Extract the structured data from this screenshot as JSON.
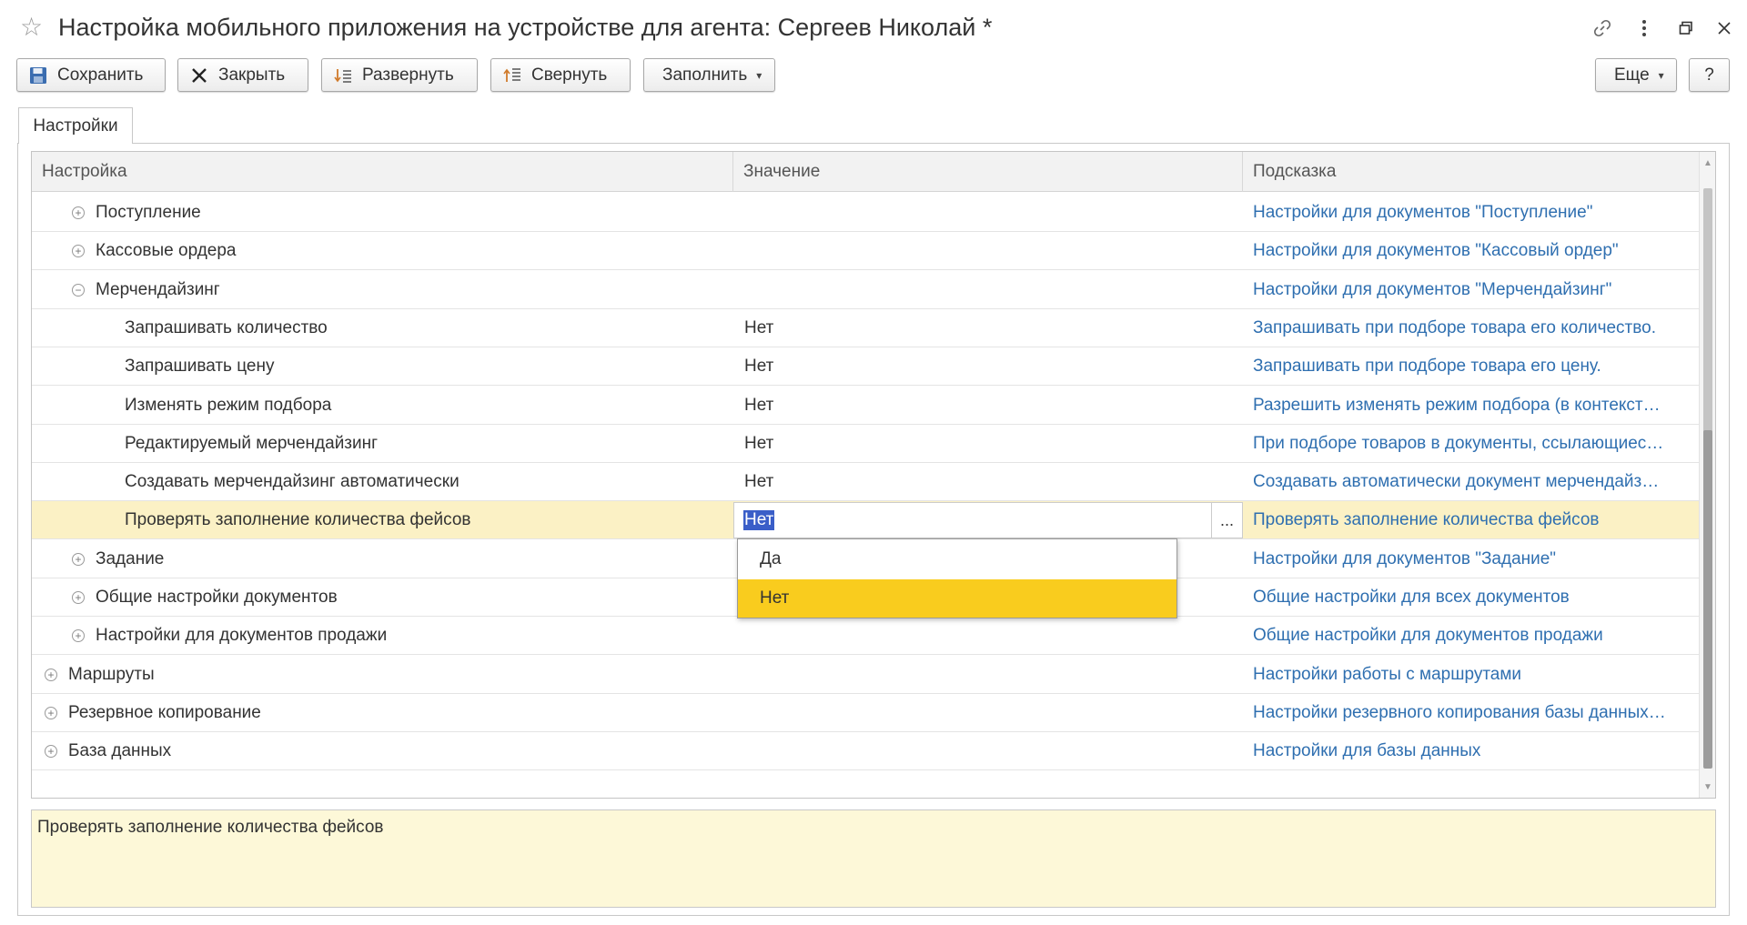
{
  "window": {
    "title": "Настройка мобильного приложения на устройстве для агента: Сергеев Николай *",
    "icons": [
      "star-icon",
      "link-icon",
      "more-icon",
      "restore-icon",
      "close-icon"
    ]
  },
  "toolbar": {
    "save_label": "Сохранить",
    "close_label": "Закрыть",
    "expand_label": "Развернуть",
    "collapse_label": "Свернуть",
    "fill_label": "Заполнить",
    "more_label": "Еще",
    "help_label": "?"
  },
  "tabs": [
    {
      "label": "Настройки"
    }
  ],
  "grid": {
    "columns": [
      "Настройка",
      "Значение",
      "Подсказка"
    ],
    "rows": [
      {
        "name": "Поступление",
        "expander": "+",
        "value": "",
        "hint": "Настройки для документов \"Поступление\""
      },
      {
        "name": "Кассовые ордера",
        "expander": "+",
        "value": "",
        "hint": "Настройки для документов \"Кассовый ордер\""
      },
      {
        "name": "Мерчендайзинг",
        "expander": "−",
        "value": "",
        "hint": "Настройки для документов \"Мерчендайзинг\""
      },
      {
        "name": "Запрашивать количество",
        "expander": "",
        "value": "Нет",
        "hint": "Запрашивать при подборе товара его количество."
      },
      {
        "name": "Запрашивать цену",
        "expander": "",
        "value": "Нет",
        "hint": "Запрашивать при подборе товара его цену."
      },
      {
        "name": "Изменять режим подбора",
        "expander": "",
        "value": "Нет",
        "hint": "Разрешить изменять режим подбора (в контекст…"
      },
      {
        "name": "Редактируемый мерчендайзинг",
        "expander": "",
        "value": "Нет",
        "hint": "При подборе товаров в документы, ссылающиес…"
      },
      {
        "name": "Создавать мерчендайзинг автоматически",
        "expander": "",
        "value": "Нет",
        "hint": "Создавать автоматически документ мерчендайз…"
      },
      {
        "name": "Проверять заполнение количества фейсов",
        "expander": "",
        "value": "Нет",
        "hint": "Проверять заполнение количества фейсов",
        "selected": true,
        "editing": true
      },
      {
        "name": "Задание",
        "expander": "+",
        "value": "",
        "hint": "Настройки для документов \"Задание\""
      },
      {
        "name": "Общие настройки документов",
        "expander": "+",
        "value": "",
        "hint": "Общие настройки для всех документов"
      },
      {
        "name": "Настройки для документов продажи",
        "expander": "+",
        "value": "",
        "hint": "Общие настройки для документов продажи"
      },
      {
        "name": "Маршруты",
        "expander": "+",
        "value": "",
        "hint": "Настройки работы с маршрутами"
      },
      {
        "name": "Резервное копирование",
        "expander": "+",
        "value": "",
        "hint": "Настройки резервного копирования базы данных…"
      },
      {
        "name": "База данных",
        "expander": "+",
        "value": "",
        "hint": "Настройки для базы данных"
      }
    ],
    "editor_ellipsis": "..."
  },
  "dropdown": {
    "options": [
      "Да",
      "Нет"
    ],
    "selected": "Нет"
  },
  "info": {
    "text": "Проверять заполнение количества фейсов"
  },
  "colors": {
    "hint_link": "#2f6fb0",
    "selected_row": "#fbf1c5",
    "dropdown_active": "#f9cc1e",
    "info_bg": "#fdf8d8",
    "text_highlight": "#3a5ec8"
  }
}
